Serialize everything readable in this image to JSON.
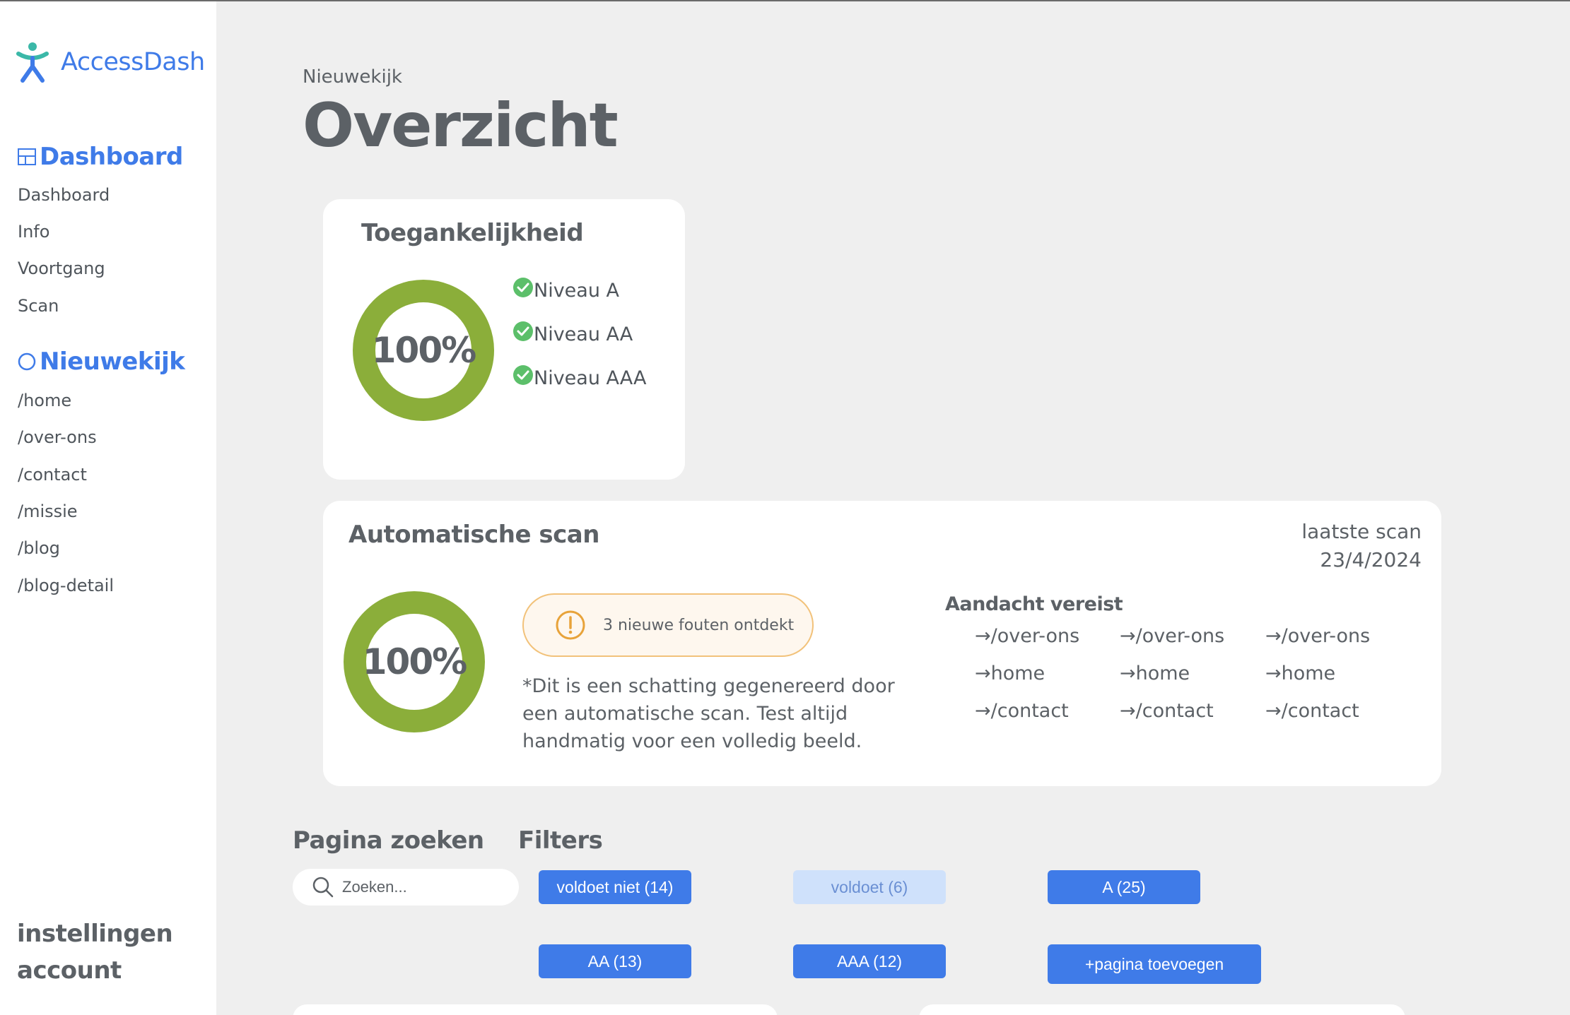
{
  "app": {
    "name": "AccessDash",
    "accent": "#3f7be8",
    "success": "#8bae3a",
    "warning": "#e8a33a"
  },
  "sidebar": {
    "sections": [
      {
        "label": "Dashboard",
        "icon": "layout-icon",
        "items": [
          "Dashboard",
          "Info",
          "Voortgang",
          "Scan"
        ]
      },
      {
        "label": "Nieuwekijk",
        "icon": "circle-icon",
        "items": [
          "/home",
          "/over-ons",
          "/contact",
          "/missie",
          "/blog",
          "/blog-detail"
        ]
      }
    ],
    "bottom": [
      "instellingen",
      "account"
    ]
  },
  "header": {
    "breadcrumb": "Nieuwekijk",
    "title": "Overzicht"
  },
  "accessibility_card": {
    "title": "Toegankelijkheid",
    "score": "100%",
    "score_value": 100,
    "levels": [
      "Niveau A",
      "Niveau AA",
      "Niveau AAA"
    ]
  },
  "scan_card": {
    "title": "Automatische scan",
    "last_scan_label": "laatste scan",
    "last_scan_date": "23/4/2024",
    "score": "100%",
    "score_value": 100,
    "alert": "3 nieuwe fouten ontdekt",
    "disclaimer": "*Dit is een schatting gegenereerd door een automatische scan. Test altijd handmatig voor een volledig beeld.",
    "attention_title": "Aandacht vereist",
    "attention_links": [
      [
        "/over-ons",
        "/over-ons",
        "/over-ons"
      ],
      [
        "home",
        "home",
        "home"
      ],
      [
        "/contact",
        "/contact",
        "/contact"
      ]
    ]
  },
  "search": {
    "label": "Pagina zoeken",
    "placeholder": "Zoeken..."
  },
  "filters": {
    "label": "Filters",
    "buttons": [
      {
        "label": "voldoet niet (14)",
        "active": true
      },
      {
        "label": "voldoet (6)",
        "active": false
      },
      {
        "label": "A (25)",
        "active": true
      },
      {
        "label": "AA (13)",
        "active": true
      },
      {
        "label": "AAA (12)",
        "active": true
      }
    ],
    "add_page": "+pagina toevoegen"
  }
}
